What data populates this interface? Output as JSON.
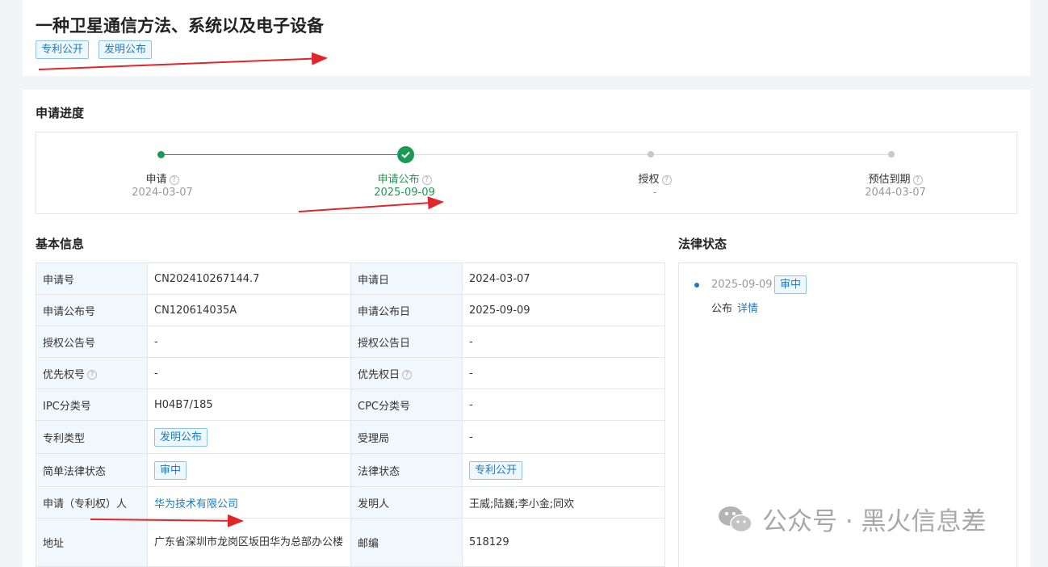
{
  "header": {
    "title": "一种卫星通信方法、系统以及电子设备",
    "tags": [
      "专利公开",
      "发明公布"
    ]
  },
  "progress": {
    "section_title": "申请进度",
    "steps": [
      {
        "label": "申请",
        "date": "2024-03-07",
        "status": "done"
      },
      {
        "label": "申请公布",
        "date": "2025-09-09",
        "status": "current"
      },
      {
        "label": "授权",
        "date": "-",
        "status": "pending"
      },
      {
        "label": "预估到期",
        "date": "2044-03-07",
        "status": "pending"
      }
    ]
  },
  "basic_info": {
    "section_title": "基本信息",
    "rows": [
      {
        "l1": "申请号",
        "v1": "CN202410267144.7",
        "l2": "申请日",
        "v2": "2024-03-07"
      },
      {
        "l1": "申请公布号",
        "v1": "CN120614035A",
        "l2": "申请公布日",
        "v2": "2025-09-09"
      },
      {
        "l1": "授权公告号",
        "v1": "-",
        "l2": "授权公告日",
        "v2": "-"
      },
      {
        "l1": "优先权号",
        "v1": "-",
        "l2": "优先权日",
        "v2": "-"
      },
      {
        "l1": "IPC分类号",
        "v1": "H04B7/185",
        "l2": "CPC分类号",
        "v2": "-"
      },
      {
        "l1": "专利类型",
        "v1": "发明公布",
        "l2": "受理局",
        "v2": "-"
      },
      {
        "l1": "简单法律状态",
        "v1": "审中",
        "l2": "法律状态",
        "v2": "专利公开"
      },
      {
        "l1": "申请（专利权）人",
        "v1": "华为技术有限公司",
        "l2": "发明人",
        "v2": "王威;陆巍;李小金;同欢"
      },
      {
        "l1": "地址",
        "v1": "广东省深圳市龙岗区坂田华为总部办公楼",
        "l2": "邮编",
        "v2": "518129"
      }
    ]
  },
  "legal_status": {
    "section_title": "法律状态",
    "entries": [
      {
        "date": "2025-09-09",
        "badge": "审中",
        "event": "公布",
        "link": "详情"
      }
    ]
  },
  "watermark": {
    "text": "公众号 · 黑火信息差"
  },
  "colors": {
    "accent": "#1f7bbf",
    "success": "#1a9a54",
    "arrow": "#e0262a"
  }
}
